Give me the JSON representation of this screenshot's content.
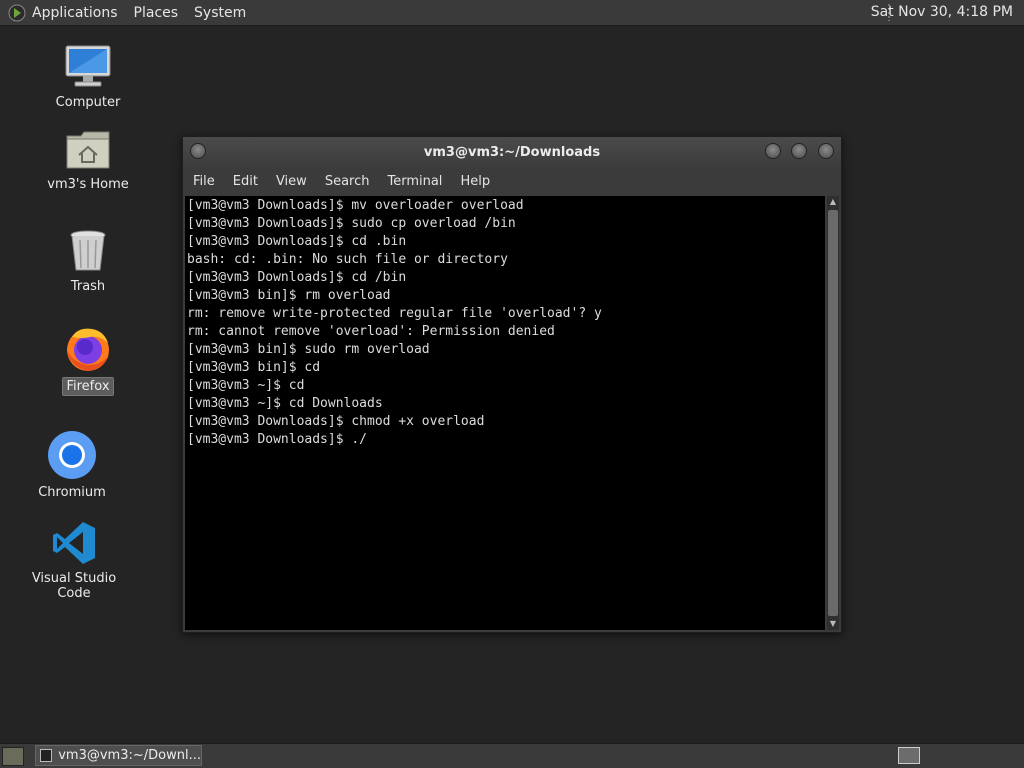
{
  "top_panel": {
    "menus": [
      "Applications",
      "Places",
      "System"
    ],
    "clock": "Sat Nov 30,  4:18 PM"
  },
  "desktop_icons": [
    {
      "label": "Computer"
    },
    {
      "label": "vm3's Home"
    },
    {
      "label": "Trash"
    },
    {
      "label": "Firefox",
      "selected": true
    },
    {
      "label": "Chromium"
    },
    {
      "label": "Visual Studio Code"
    }
  ],
  "terminal": {
    "title": "vm3@vm3:~/Downloads",
    "menu": [
      "File",
      "Edit",
      "View",
      "Search",
      "Terminal",
      "Help"
    ],
    "lines": [
      "[vm3@vm3 Downloads]$ mv overloader overload",
      "[vm3@vm3 Downloads]$ sudo cp overload /bin",
      "[vm3@vm3 Downloads]$ cd .bin",
      "bash: cd: .bin: No such file or directory",
      "[vm3@vm3 Downloads]$ cd /bin",
      "[vm3@vm3 bin]$ rm overload",
      "rm: remove write-protected regular file 'overload'? y",
      "rm: cannot remove 'overload': Permission denied",
      "[vm3@vm3 bin]$ sudo rm overload",
      "[vm3@vm3 bin]$ cd",
      "[vm3@vm3 ~]$ cd",
      "[vm3@vm3 ~]$ cd Downloads",
      "[vm3@vm3 Downloads]$ chmod +x overload",
      "[vm3@vm3 Downloads]$ ./"
    ]
  },
  "taskbar": {
    "task_label": "vm3@vm3:~/Downl..."
  }
}
